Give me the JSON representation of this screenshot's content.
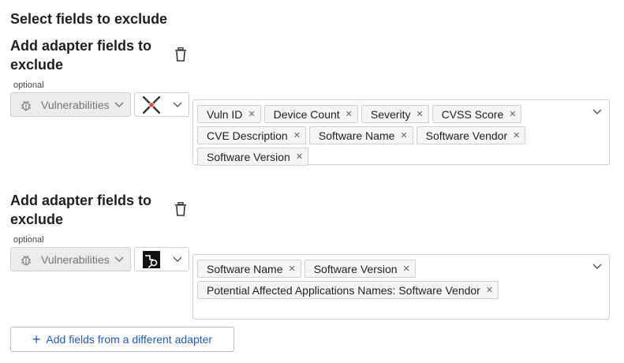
{
  "page": {
    "title": "Select fields to exclude"
  },
  "sections": [
    {
      "title": "Add adapter fields to exclude",
      "optional": "optional",
      "entity": "Vulnerabilities",
      "adapter_icon": "crosshair-logo-icon",
      "fields": [
        "Vuln ID",
        "Device Count",
        "Severity",
        "CVSS Score",
        "CVE Description",
        "Software Name",
        "Software Vendor",
        "Software Version"
      ]
    },
    {
      "title": "Add adapter fields to exclude",
      "optional": "optional",
      "entity": "Vulnerabilities",
      "adapter_icon": "link-logo-icon",
      "fields": [
        "Software Name",
        "Software Version",
        "Potential Affected Applications Names: Software Vendor"
      ]
    }
  ],
  "add_adapter_button": {
    "label": "Add fields from a different adapter"
  },
  "colors": {
    "accent": "#1e5bbf",
    "chip_bg": "#f5f5f5",
    "entity_bg": "#ececec"
  }
}
